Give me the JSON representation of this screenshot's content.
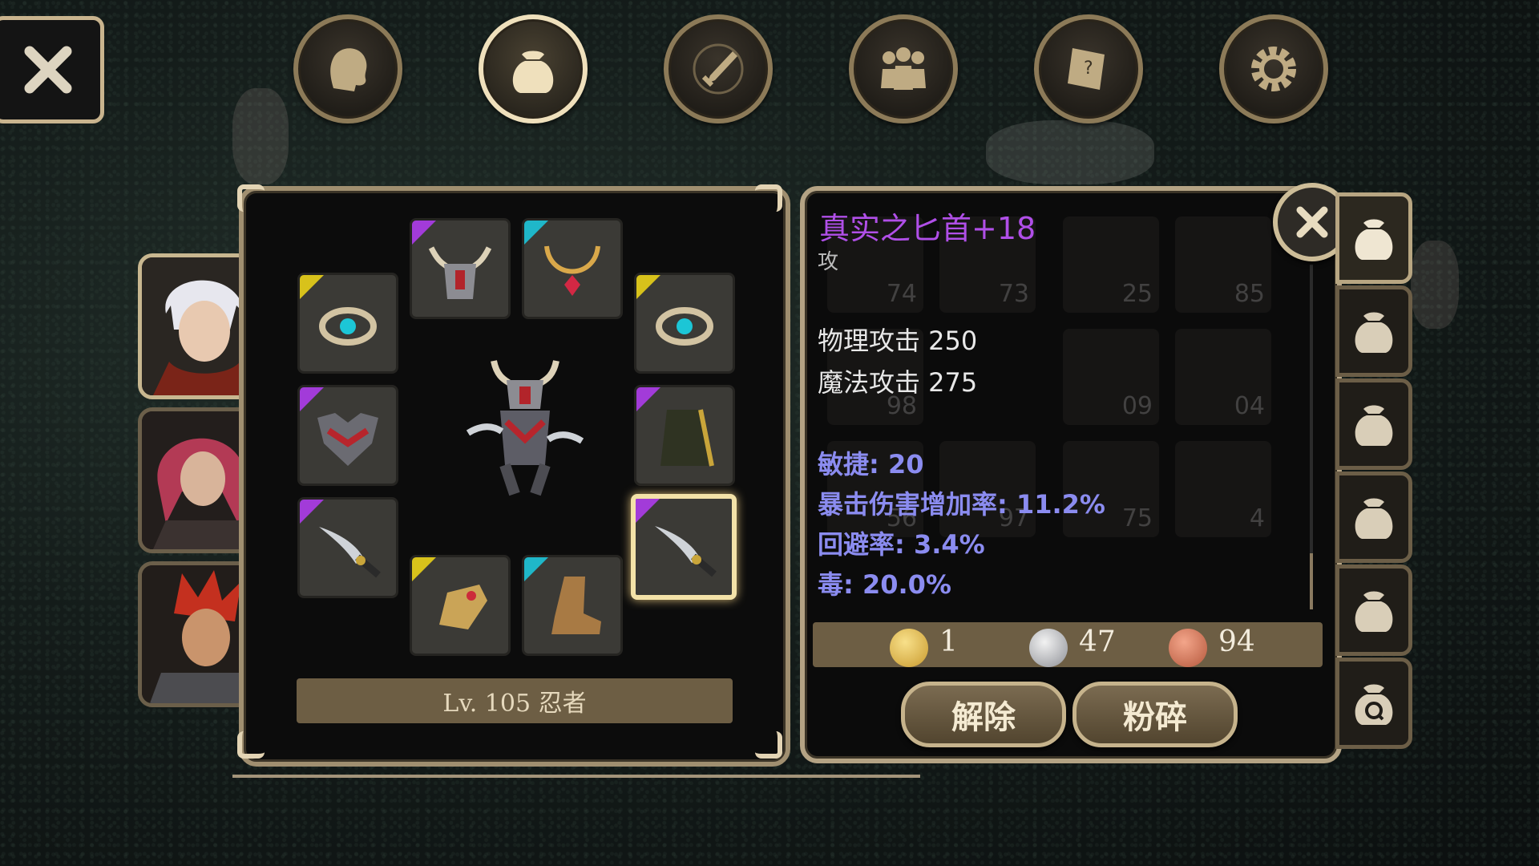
{
  "colors": {
    "gold_border": "#c9b48e",
    "panel_bg": "#0b0b0b",
    "item_name": "#b04fe8",
    "stat_blue": "#8b8cf0",
    "rarity_purple": "#a23bd9",
    "rarity_yellow": "#d8c21b",
    "rarity_cyan": "#1fb7c9"
  },
  "nav": {
    "close_icon": "close-icon",
    "tabs": [
      {
        "id": "character",
        "icon": "head-icon",
        "active": false
      },
      {
        "id": "inventory",
        "icon": "bag-icon",
        "active": true
      },
      {
        "id": "skills",
        "icon": "sword-compass-icon",
        "active": false
      },
      {
        "id": "party",
        "icon": "group-icon",
        "active": false
      },
      {
        "id": "quests",
        "icon": "scroll-icon",
        "active": false
      },
      {
        "id": "settings",
        "icon": "gear-icon",
        "active": false
      }
    ]
  },
  "party": [
    {
      "name": "white-hair-ninja",
      "active": true
    },
    {
      "name": "pink-hair-warrior",
      "active": false
    },
    {
      "name": "red-hair-knight",
      "active": false
    }
  ],
  "equipment": {
    "slots": [
      {
        "id": "ring-left",
        "rarity": "yellow",
        "icon": "ring-icon"
      },
      {
        "id": "helmet",
        "rarity": "purple",
        "icon": "horned-helmet-icon"
      },
      {
        "id": "necklace",
        "rarity": "cyan",
        "icon": "necklace-icon"
      },
      {
        "id": "ring-right",
        "rarity": "yellow",
        "icon": "ring-icon"
      },
      {
        "id": "armor",
        "rarity": "purple",
        "icon": "armor-icon"
      },
      {
        "id": "cloak",
        "rarity": "purple",
        "icon": "cloak-icon"
      },
      {
        "id": "weapon-left",
        "rarity": "purple",
        "icon": "dagger-icon"
      },
      {
        "id": "gloves",
        "rarity": "yellow",
        "icon": "gauntlet-icon"
      },
      {
        "id": "boots",
        "rarity": "cyan",
        "icon": "boot-icon"
      },
      {
        "id": "weapon-right",
        "rarity": "purple",
        "icon": "dagger-icon",
        "selected": true
      }
    ],
    "level_label": "Lv. 105 忍者"
  },
  "item": {
    "name": "真实之匕首+18",
    "truncated_line": "攻",
    "stats": [
      {
        "label": "物理攻击 250",
        "style": "white"
      },
      {
        "label": "魔法攻击 275",
        "style": "white"
      },
      {
        "label": "敏捷: 20",
        "style": "blue"
      },
      {
        "label": "暴击伤害增加率: 11.2%",
        "style": "blue"
      },
      {
        "label": "回避率: 3.4%",
        "style": "blue"
      },
      {
        "label": "毒: 20.0%",
        "style": "blue"
      }
    ],
    "unequip_label": "解除",
    "destroy_label": "粉碎"
  },
  "currency": {
    "gold": "1",
    "silver": "47",
    "copper": "94"
  },
  "background_inventory_counts": [
    "74",
    "73",
    "25",
    "85",
    "98",
    "09",
    "04",
    "56",
    "97",
    "75",
    "4"
  ],
  "bag_tabs": [
    {
      "icon": "bag-icon",
      "active": true
    },
    {
      "icon": "bag-icon",
      "active": false
    },
    {
      "icon": "bag-icon",
      "active": false
    },
    {
      "icon": "bag-icon",
      "active": false
    },
    {
      "icon": "bag-icon",
      "active": false
    },
    {
      "icon": "quest-bag-icon",
      "active": false
    }
  ]
}
